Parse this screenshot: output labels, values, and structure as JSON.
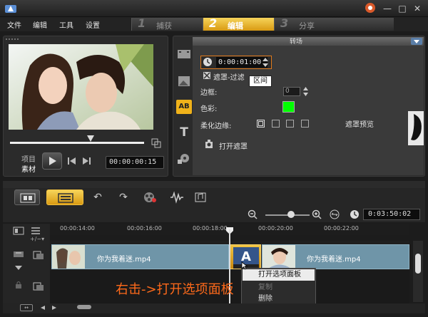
{
  "menu": {
    "file": "文件",
    "edit": "编辑",
    "tools": "工具",
    "settings": "设置"
  },
  "steps": [
    {
      "num": "1",
      "label": "捕获"
    },
    {
      "num": "2",
      "label": "编辑"
    },
    {
      "num": "3",
      "label": "分享"
    }
  ],
  "preview": {
    "mode_project": "项目",
    "mode_clip": "素材",
    "timecode": "00:00:00:15"
  },
  "options": {
    "header": "转场",
    "duration": "0:00:01:00",
    "duration_tooltip": "区间",
    "mask_filter": "遮罩-过滤",
    "border_label": "边框:",
    "border_value": "0",
    "color_label": "色彩:",
    "color_value": "#00ff00",
    "soften_label": "柔化边缘:",
    "mask_preview_label": "遮罩预览",
    "open_mask": "打开遮罩"
  },
  "timeline": {
    "total_timecode": "0:03:50:02",
    "ruler": [
      "00:00:14:00",
      "00:00:16:00",
      "00:00:18:00",
      "00:00:20:00",
      "00:00:22:00"
    ],
    "clip_name": "你为我着迷.mp4"
  },
  "context_menu": {
    "items": [
      {
        "label": "打开选项面板",
        "state": "hover"
      },
      {
        "label": "复制",
        "state": "disabled"
      },
      {
        "label": "删除",
        "state": "normal"
      }
    ]
  },
  "annotation": "右击->打开选项面板",
  "colors": {
    "accent": "#e8a418",
    "annotation": "#ff6a1a",
    "clip": "#6f95a8"
  }
}
